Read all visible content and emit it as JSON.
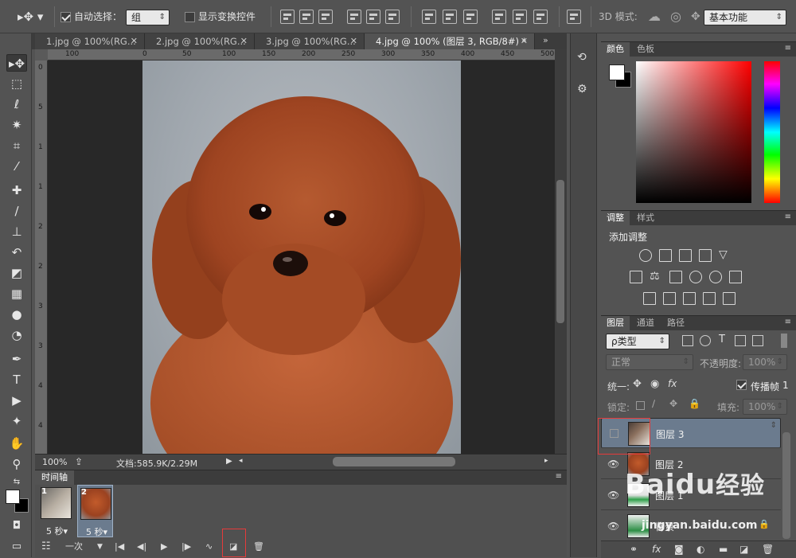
{
  "options_bar": {
    "auto_select_label": "自动选择：",
    "auto_select_value": "组",
    "show_transform_label": "显示变换控件",
    "mode_3d_label": "3D 模式:",
    "workspace_value": "基本功能"
  },
  "doc_tabs": [
    {
      "label": "1.jpg @ 100%(RG...",
      "active": false
    },
    {
      "label": "2.jpg @ 100%(RG...",
      "active": false
    },
    {
      "label": "3.jpg @ 100%(RG...",
      "active": false
    },
    {
      "label": "4.jpg @ 100% (图层 3, RGB/8#) *",
      "active": true
    }
  ],
  "ruler_h": [
    "100",
    "0",
    "50",
    "100",
    "150",
    "200",
    "250",
    "300",
    "350",
    "400",
    "450",
    "500"
  ],
  "ruler_v": [
    "0",
    "5",
    "1",
    "1",
    "2",
    "2",
    "3",
    "3",
    "4",
    "4"
  ],
  "status": {
    "zoom": "100%",
    "doc_label": "文档:585.9K/2.29M"
  },
  "timeline": {
    "tab_label": "时间轴",
    "frames": [
      {
        "num": "1",
        "duration": "5 秒▾",
        "selected": false
      },
      {
        "num": "2",
        "duration": "5 秒▾",
        "selected": true
      }
    ],
    "loop_label": "一次"
  },
  "color_panel": {
    "tabs": [
      "颜色",
      "色板"
    ],
    "foreground": "#ffffff",
    "background": "#000000"
  },
  "adjust_panel": {
    "tabs": [
      "调整",
      "样式"
    ],
    "title": "添加调整"
  },
  "layers_panel": {
    "tabs": [
      "图层",
      "通道",
      "路径"
    ],
    "filter_value": "ρ类型",
    "blend_mode": "正常",
    "opacity_label": "不透明度:",
    "opacity_value": "100%",
    "unify_label": "统一:",
    "propagate_label": "传播帧",
    "propagate_value": "1",
    "lock_label": "锁定:",
    "fill_label": "填充:",
    "fill_value": "100%",
    "layers": [
      {
        "name": "图层 3",
        "visible": false,
        "selected": true
      },
      {
        "name": "图层 2",
        "visible": true,
        "selected": false
      },
      {
        "name": "图层 1",
        "visible": true,
        "selected": false
      },
      {
        "name": "背景",
        "visible": true,
        "selected": false
      }
    ]
  },
  "watermark": {
    "brand": "Baidu",
    "brand_cn": "经验",
    "url": "jingyan.baidu.com"
  }
}
